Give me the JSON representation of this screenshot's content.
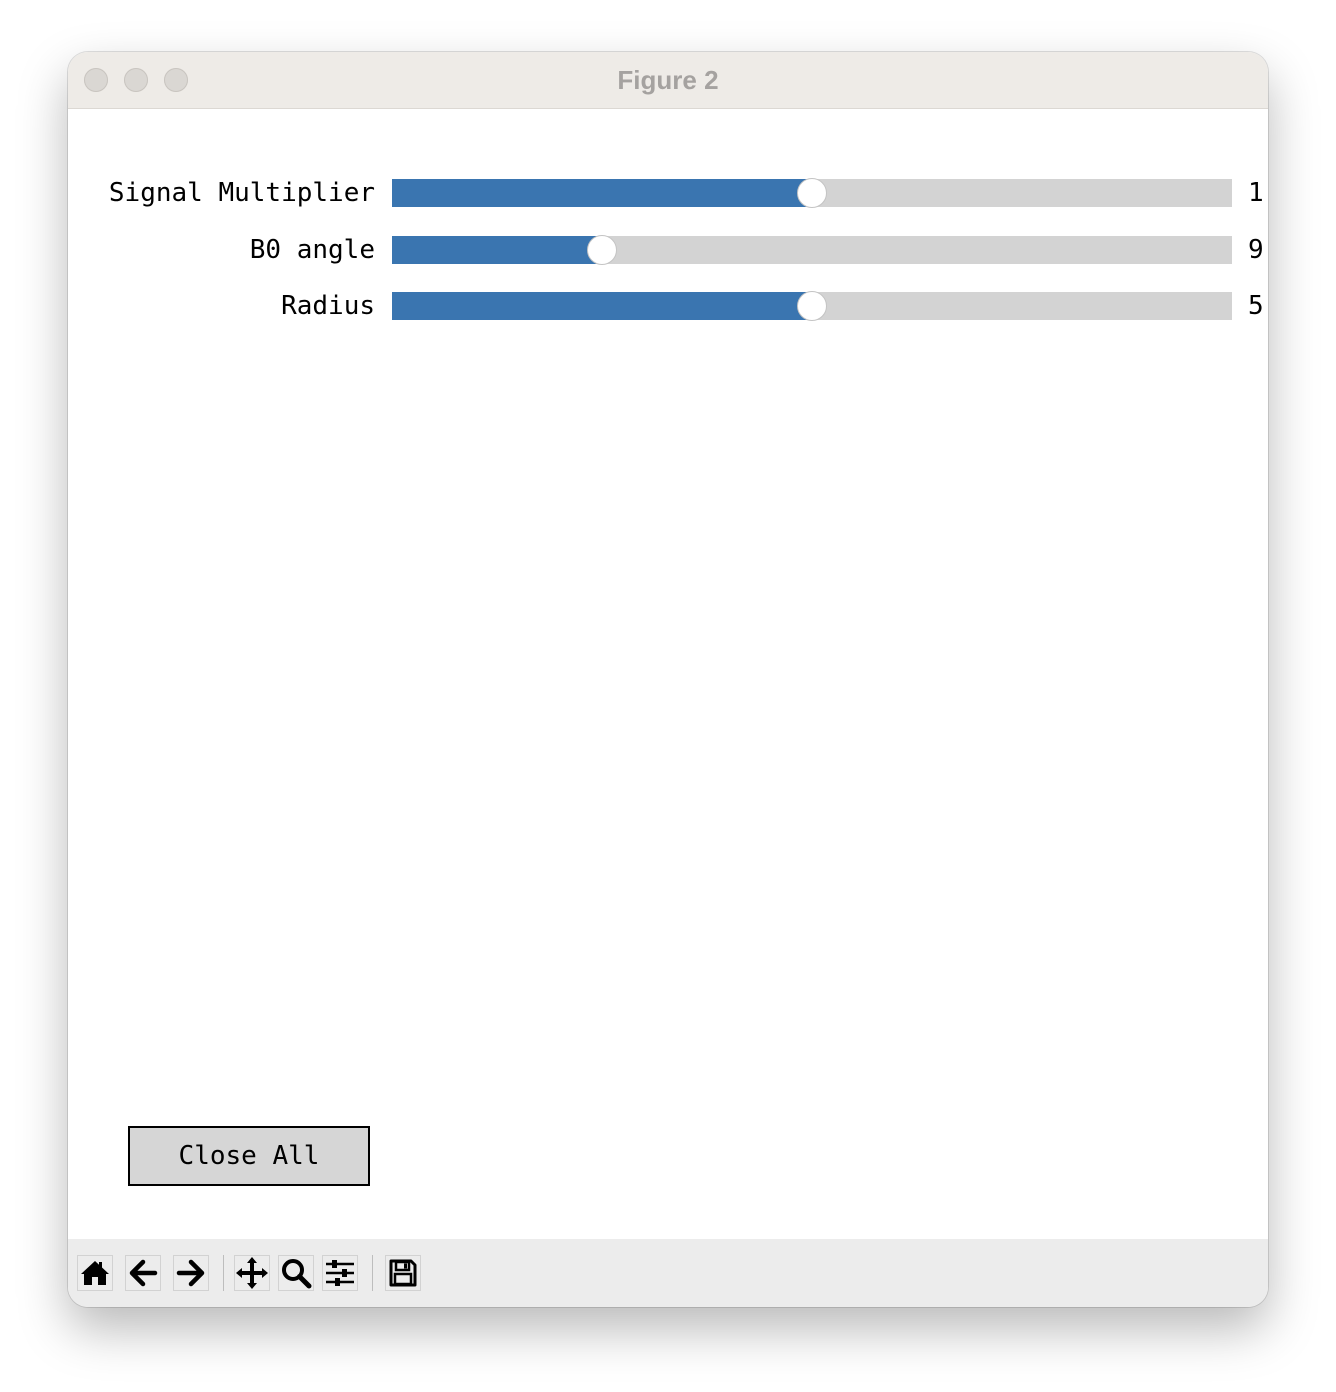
{
  "window": {
    "title": "Figure 2"
  },
  "sliders": [
    {
      "label": "Signal Multiplier",
      "value_text": "1",
      "fraction": 0.5
    },
    {
      "label": "B0 angle",
      "value_text": "9",
      "fraction": 0.25
    },
    {
      "label": "Radius",
      "value_text": "5",
      "fraction": 0.5
    }
  ],
  "buttons": {
    "close_all": "Close All"
  },
  "toolbar": {
    "tools": [
      "home-icon",
      "back-arrow-icon",
      "forward-arrow-icon",
      "pan-icon",
      "zoom-icon",
      "configure-subplots-icon",
      "save-icon"
    ]
  },
  "colors": {
    "slider_fill": "#3a75b0",
    "slider_track": "#d3d3d3",
    "titlebar": "#eeebe7",
    "toolbar": "#ececec"
  }
}
